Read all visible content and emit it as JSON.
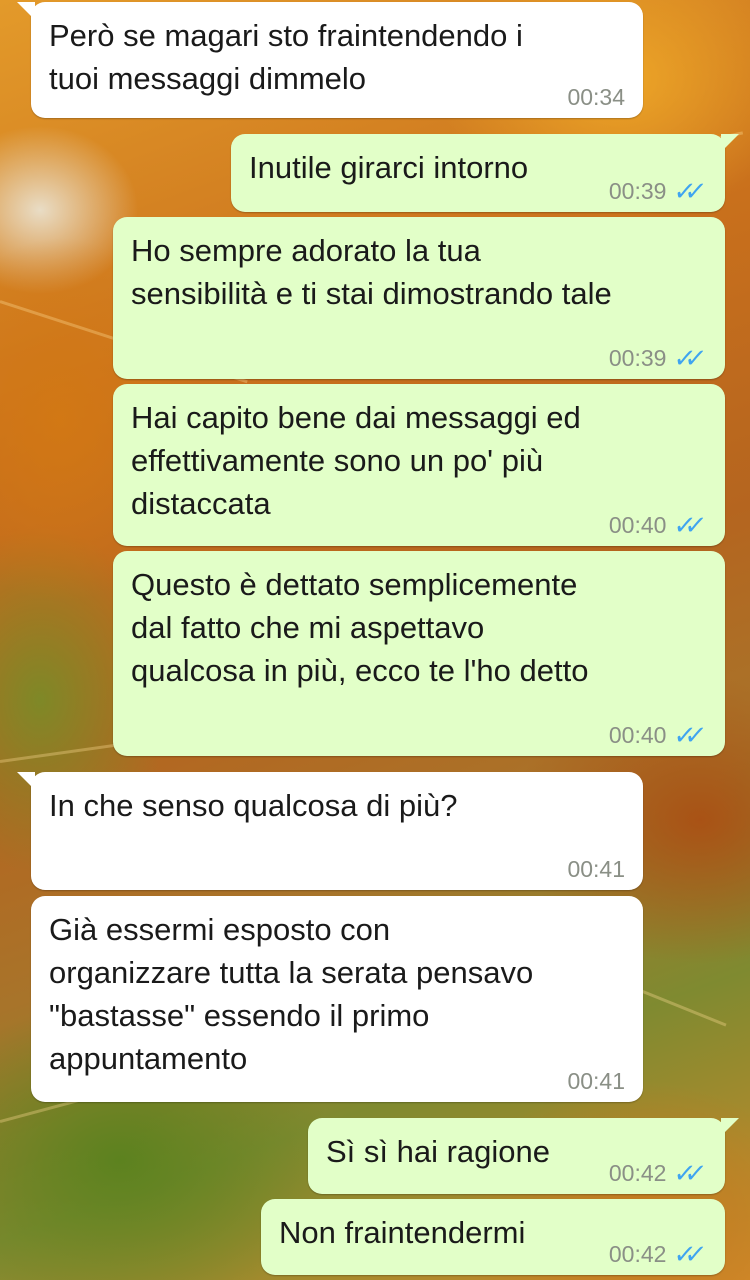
{
  "messages": [
    {
      "direction": "in",
      "text": "Però se magari sto fraintendendo i\ntuoi messaggi dimmelo",
      "time": "00:34"
    },
    {
      "direction": "out",
      "text": "Inutile girarci intorno",
      "time": "00:39",
      "status_icon": "double-check-icon"
    },
    {
      "direction": "out",
      "text": "Ho sempre adorato la tua\nsensibilità e ti stai dimostrando tale",
      "time": "00:39",
      "status_icon": "double-check-icon"
    },
    {
      "direction": "out",
      "text": "Hai capito bene dai messaggi ed\neffettivamente sono un po' più\ndistaccata",
      "time": "00:40",
      "status_icon": "double-check-icon"
    },
    {
      "direction": "out",
      "text": "Questo è dettato semplicemente\ndal fatto che mi aspettavo\nqualcosa in più, ecco te l'ho detto",
      "time": "00:40",
      "status_icon": "double-check-icon"
    },
    {
      "direction": "in",
      "text": "In che senso qualcosa di più?",
      "time": "00:41"
    },
    {
      "direction": "in",
      "text": "Già essermi esposto con\norganizzare tutta la serata pensavo\n\"bastasse\" essendo il primo\nappuntamento",
      "time": "00:41"
    },
    {
      "direction": "out",
      "text": "Sì sì hai ragione",
      "time": "00:42",
      "status_icon": "double-check-icon"
    },
    {
      "direction": "out",
      "text": "Non fraintendermi",
      "time": "00:42",
      "status_icon": "double-check-icon"
    }
  ],
  "colors": {
    "incoming_bubble": "#ffffff",
    "outgoing_bubble": "#e2ffc8",
    "read_ticks": "#3fa4f0",
    "timestamp": "#8a8f86"
  }
}
